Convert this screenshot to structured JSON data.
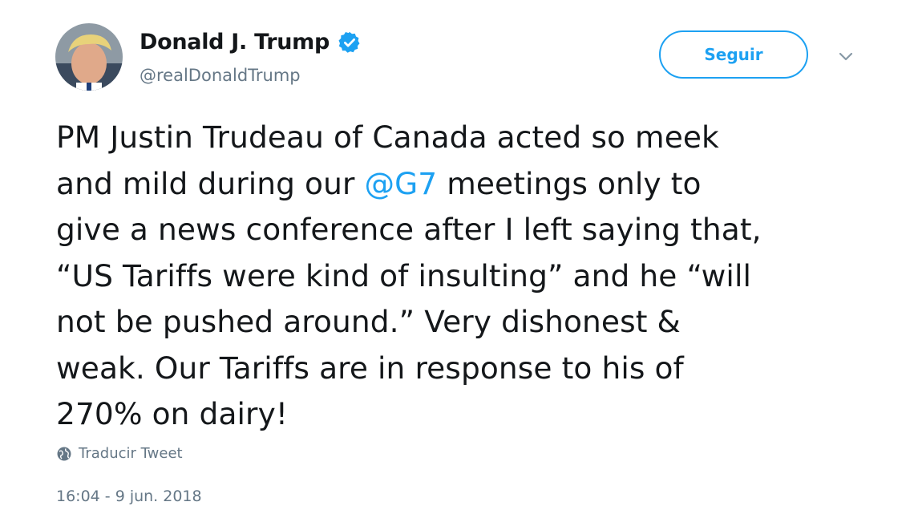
{
  "user": {
    "display_name": "Donald J. Trump",
    "handle": "@realDonaldTrump",
    "verified": true
  },
  "follow_button": {
    "label": "Seguir"
  },
  "tweet": {
    "lines": [
      [
        "PM Justin Trudeau of Canada acted so meek"
      ],
      [
        "and mild during our ",
        "@G7",
        " meetings only to"
      ],
      [
        "give a news conference after I left saying that,"
      ],
      [
        "“US Tariffs were kind of insulting” and he “will"
      ],
      [
        "not be pushed around.” Very dishonest &"
      ],
      [
        "weak. Our Tariffs are in response to his of"
      ],
      [
        "270% on dairy!"
      ]
    ]
  },
  "translate": {
    "label": "Traducir Tweet",
    "icon": "globe-icon"
  },
  "timestamp": "16:04 - 9 jun. 2018",
  "colors": {
    "accent": "#1da1f2",
    "text": "#14171a",
    "muted": "#657786"
  },
  "icons": {
    "verified": "verified-badge-icon",
    "menu": "chevron-down-icon"
  }
}
